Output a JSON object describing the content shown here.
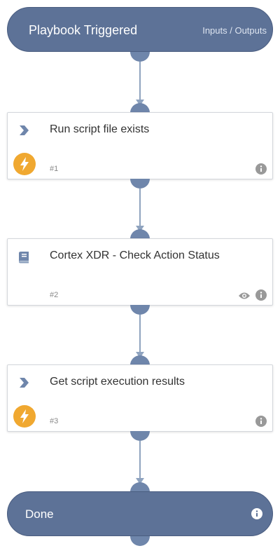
{
  "start": {
    "title": "Playbook Triggered",
    "io_link": "Inputs / Outputs"
  },
  "tasks": [
    {
      "label": "Run script file exists",
      "number": "#1",
      "icon": "chevron-icon",
      "automated": true,
      "view": false
    },
    {
      "label": "Cortex XDR - Check Action Status",
      "number": "#2",
      "icon": "book-icon",
      "automated": false,
      "view": true
    },
    {
      "label": "Get script execution results",
      "number": "#3",
      "icon": "chevron-icon",
      "automated": true,
      "view": false
    }
  ],
  "end": {
    "title": "Done"
  },
  "colors": {
    "node_fill": "#5d7297",
    "port": "#6f86ab",
    "edge": "#8fa3bf",
    "automation_badge": "#f0a830",
    "icon_grey": "#999999"
  }
}
